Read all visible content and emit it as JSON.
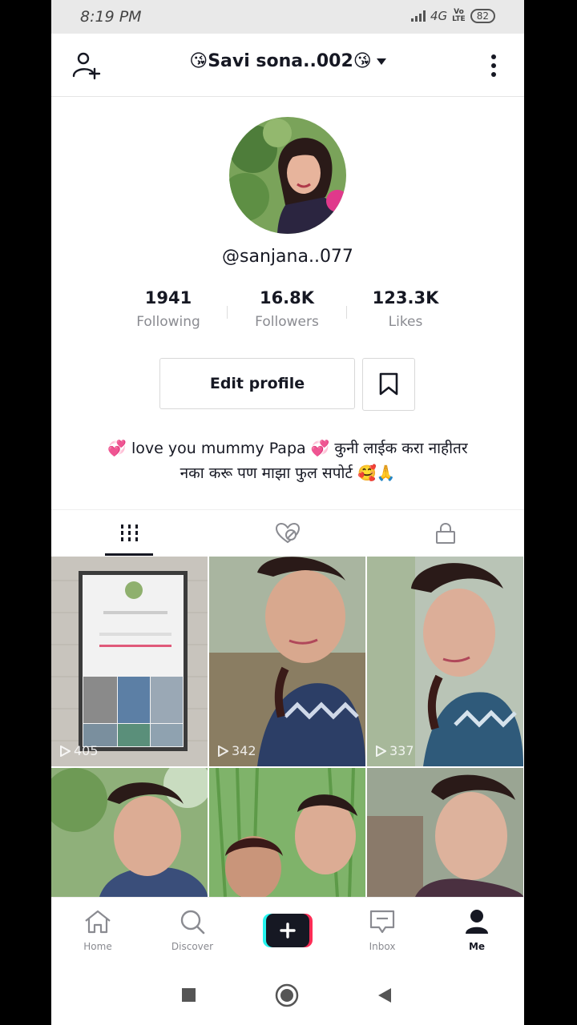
{
  "status": {
    "time": "8:19 PM",
    "network": "4G",
    "volte_top": "Vo",
    "volte_bottom": "LTE",
    "battery": "82"
  },
  "header": {
    "title": "😘Savi sona..002😘",
    "add_friend_icon": "person-add-icon",
    "more_icon": "more-vertical-icon"
  },
  "profile": {
    "username": "@sanjana..077",
    "stats": [
      {
        "value": "1941",
        "label": "Following"
      },
      {
        "value": "16.8K",
        "label": "Followers"
      },
      {
        "value": "123.3K",
        "label": "Likes"
      }
    ],
    "edit_button": "Edit profile",
    "bio_line1": "💞 love you mummy Papa 💞 कुनी लाईक करा नाहीतर",
    "bio_line2": "नका करू पण माझा फुल सपोर्ट 🥰🙏"
  },
  "tabs": [
    {
      "icon": "grid-icon",
      "active": true
    },
    {
      "icon": "liked-heart-hidden-icon",
      "active": false
    },
    {
      "icon": "lock-icon",
      "active": false
    }
  ],
  "videos": [
    {
      "views": "405"
    },
    {
      "views": "342"
    },
    {
      "views": "337"
    },
    {
      "views": ""
    },
    {
      "views": ""
    },
    {
      "views": ""
    }
  ],
  "nav": {
    "home": "Home",
    "discover": "Discover",
    "inbox": "Inbox",
    "me": "Me"
  },
  "colors": {
    "accent_red": "#fe2c55",
    "accent_cyan": "#25f4ee",
    "text": "#161823",
    "muted": "#8a8b91"
  }
}
